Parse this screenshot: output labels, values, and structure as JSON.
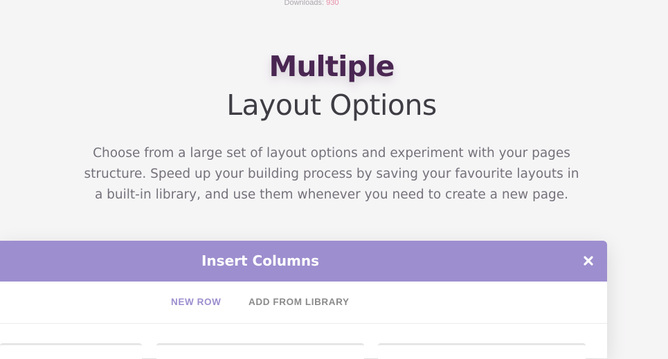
{
  "header": {
    "downloads_label": "Downloads:",
    "downloads_count": "930"
  },
  "hero": {
    "title_bold": "Multiple",
    "title_light": "Layout Options",
    "description": "Choose from a large set of layout options and experiment with your pages structure. Speed up your building process by saving your favourite layouts in a built-in library, and use them whenever you need to create a new page."
  },
  "modal": {
    "title": "Insert Columns",
    "close_icon": "close-icon",
    "tabs": [
      {
        "label": "NEW ROW",
        "active": true
      },
      {
        "label": "ADD FROM LIBRARY",
        "active": false
      }
    ]
  },
  "colors": {
    "background": "#f6f5f6",
    "title_bold": "#4a2652",
    "modal_header": "#9d8ecf",
    "active_tab": "#9d8ecf",
    "downloads_count": "#e68da6"
  }
}
